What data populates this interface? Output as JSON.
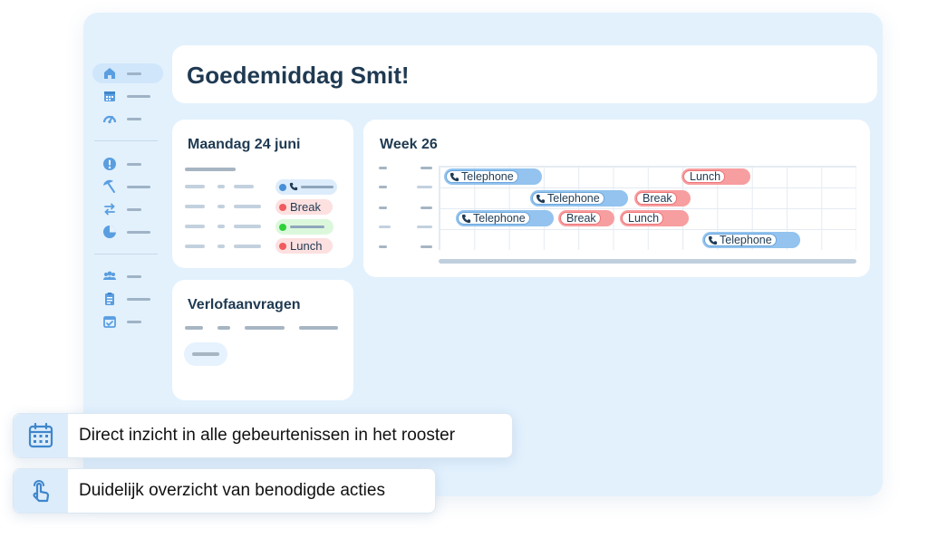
{
  "greeting": {
    "title": "Goedemiddag Smit!"
  },
  "sidebar": {
    "items": [
      {
        "icon": "home-icon",
        "active": true
      },
      {
        "icon": "calendar-icon"
      },
      {
        "icon": "dashboard-icon"
      },
      {
        "icon": "alert-icon"
      },
      {
        "icon": "beach-umbrella-icon"
      },
      {
        "icon": "swap-icon"
      },
      {
        "icon": "pie-chart-icon"
      },
      {
        "icon": "team-icon"
      },
      {
        "icon": "clipboard-icon"
      },
      {
        "icon": "calendar-check-icon"
      }
    ]
  },
  "day_card": {
    "title": "Maandag 24 juni",
    "events": [
      {
        "label": "",
        "color": "blue",
        "icon": "phone-icon"
      },
      {
        "label": "Break",
        "color": "red"
      },
      {
        "label": "",
        "color": "green"
      },
      {
        "label": "Lunch",
        "color": "red"
      }
    ]
  },
  "leave_card": {
    "title": "Verlofaanvragen"
  },
  "week_card": {
    "title": "Week 26",
    "events": [
      {
        "label": "Telephone",
        "type": "phone",
        "row": 0
      },
      {
        "label": "Lunch",
        "type": "break",
        "row": 0
      },
      {
        "label": "Telephone",
        "type": "phone",
        "row": 1
      },
      {
        "label": "Break",
        "type": "break",
        "row": 1
      },
      {
        "label": "Telephone",
        "type": "phone",
        "row": 2
      },
      {
        "label": "Break",
        "type": "break",
        "row": 2
      },
      {
        "label": "Lunch",
        "type": "break",
        "row": 2
      },
      {
        "label": "Telephone",
        "type": "phone",
        "row": 3
      }
    ]
  },
  "features": [
    {
      "icon": "calendar-grid-icon",
      "text": "Direct inzicht in alle gebeurtenissen in het rooster"
    },
    {
      "icon": "tap-hand-icon",
      "text": "Duidelijk overzicht van benodigde acties"
    }
  ],
  "colors": {
    "accent": "#5a9ee0",
    "frame_bg": "#e3f1fd",
    "phone": "#93c3ee",
    "break": "#f79ea0",
    "green": "#2fd13a"
  }
}
